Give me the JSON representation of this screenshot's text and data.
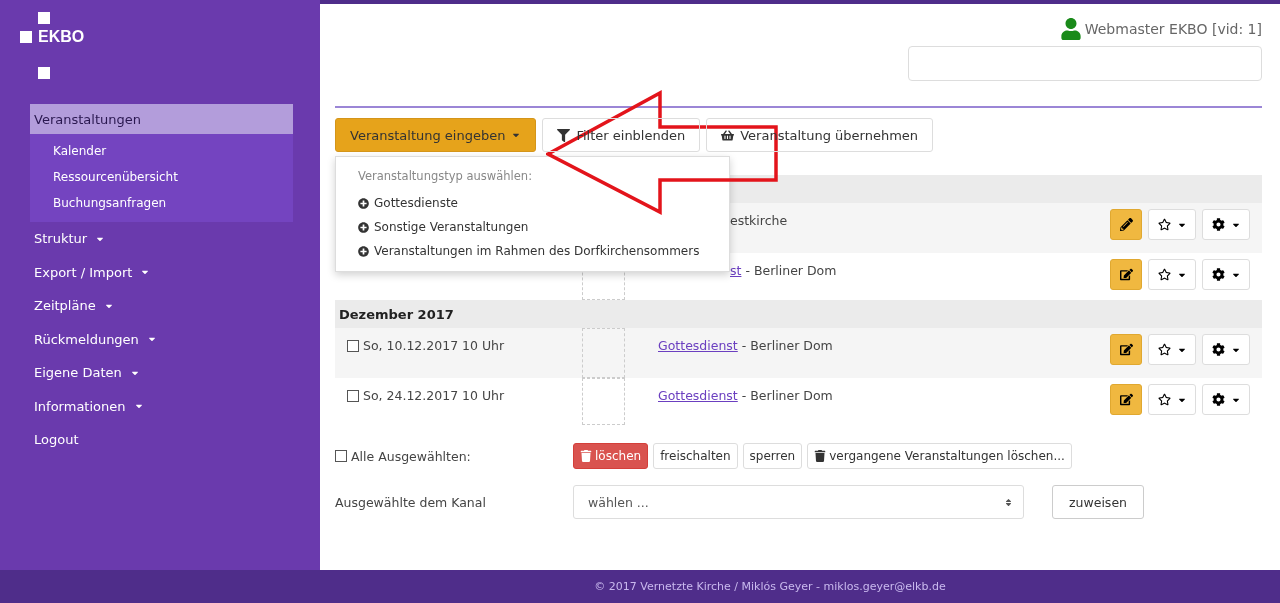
{
  "logo": {
    "text": "EKBO"
  },
  "sidebar": {
    "items": [
      {
        "label": "Veranstaltungen",
        "selected": true,
        "has_menu": false,
        "children": [
          {
            "label": "Kalender",
            "selected": false
          },
          {
            "label": "Ressourcenübersicht",
            "selected": false
          },
          {
            "label": "Buchungsanfragen",
            "selected": false
          }
        ]
      },
      {
        "label": "Struktur",
        "selected": false,
        "has_menu": true
      },
      {
        "label": "Export / Import",
        "selected": false,
        "has_menu": true
      },
      {
        "label": "Zeitpläne",
        "selected": false,
        "has_menu": true
      },
      {
        "label": "Rückmeldungen",
        "selected": false,
        "has_menu": true
      },
      {
        "label": "Eigene Daten",
        "selected": false,
        "has_menu": true
      },
      {
        "label": "Informationen",
        "selected": false,
        "has_menu": true
      },
      {
        "label": "Logout",
        "selected": false,
        "has_menu": false
      }
    ]
  },
  "user": {
    "name": "Webmaster EKBO [vid: 1]"
  },
  "toolbar": {
    "buttons": [
      {
        "label": "Veranstaltung eingeben",
        "kind": "primary"
      },
      {
        "label": "Filter einblenden",
        "kind": "filter"
      },
      {
        "label": "Veranstaltung übernehmen",
        "kind": "basket"
      }
    ]
  },
  "dropdown": {
    "open": true,
    "header": "Veranstaltungstyp auswählen:",
    "items": [
      "Gottesdienste",
      "Sonstige Veranstaltungen",
      "Veranstaltungen im Rahmen des Dorfkirchensommers"
    ]
  },
  "table": {
    "groups": [
      {
        "rows": [
          {
            "partial": true,
            "image_placeholder": false,
            "place": "estkirche",
            "kind": "pencil"
          },
          {
            "partial": true,
            "image_placeholder": true,
            "link": "st",
            "place": "- Berliner Dom",
            "kind": "square"
          }
        ]
      },
      {
        "heading": "Dezember 2017",
        "rows": [
          {
            "partial": false,
            "checked": false,
            "date": "So, 10.12.2017 10 Uhr",
            "image_placeholder": true,
            "link": "Gottesdienst",
            "place": "- Berliner Dom",
            "kind": "square"
          },
          {
            "partial": false,
            "checked": false,
            "date": "So, 24.12.2017 10 Uhr",
            "image_placeholder": true,
            "link": "Gottesdienst",
            "place": "- Berliner Dom",
            "kind": "square"
          }
        ]
      }
    ]
  },
  "bulk": {
    "label": "Alle Ausgewählten:",
    "checked": false,
    "buttons": [
      {
        "label": "löschen",
        "kind": "danger"
      },
      {
        "label": "freischalten",
        "kind": "plain"
      },
      {
        "label": "sperren",
        "kind": "plain"
      },
      {
        "label": "vergangene Veranstaltungen löschen...",
        "kind": "trash"
      }
    ]
  },
  "channel": {
    "label": "Ausgewählte dem Kanal",
    "select_value": "wählen ...",
    "button": "zuweisen"
  },
  "footer": {
    "text": "© 2017 Vernetzte Kirche / Miklós Geyer - miklos.geyer@elkb.de"
  }
}
